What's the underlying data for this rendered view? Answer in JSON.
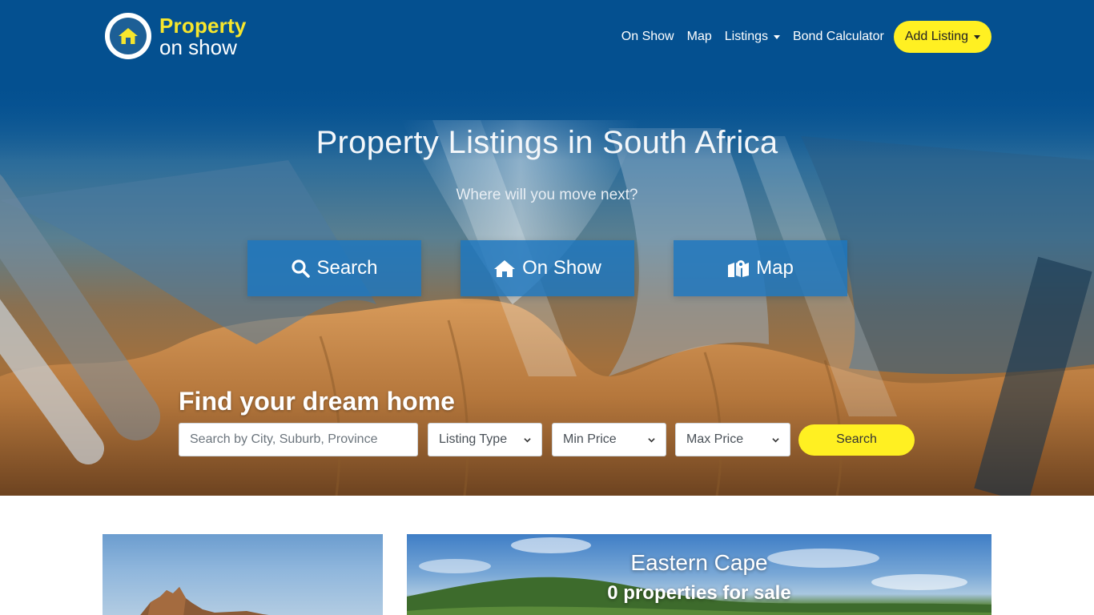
{
  "brand": {
    "logo_line1": "Property",
    "logo_line2": "on show",
    "primary_color": "#04518f",
    "accent_color": "#fff022",
    "logo_icon": "house-icon"
  },
  "nav": {
    "on_show": "On Show",
    "map": "Map",
    "listings": "Listings",
    "bond_calculator": "Bond Calculator",
    "add_listing": "Add Listing"
  },
  "hero": {
    "title": "Property Listings in South Africa",
    "subtitle": "Where will you move next?",
    "buttons": {
      "search": "Search",
      "on_show": "On Show",
      "map": "Map"
    },
    "button_icons": {
      "search": "search-icon",
      "on_show": "home-icon",
      "map": "map-icon"
    }
  },
  "search": {
    "heading": "Find your dream home",
    "placeholder": "Search by City, Suburb, Province",
    "listing_type": "Listing Type",
    "min_price": "Min Price",
    "max_price": "Max Price",
    "submit": "Search"
  },
  "regions": [
    {
      "name": "",
      "count_text": ""
    },
    {
      "name": "Eastern Cape",
      "count_text": "0 properties for sale"
    }
  ]
}
